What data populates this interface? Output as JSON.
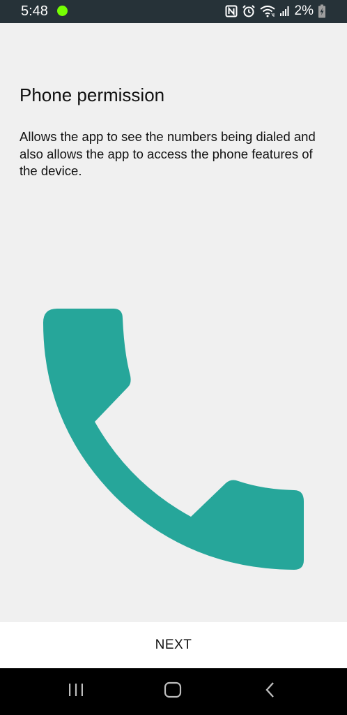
{
  "status_bar": {
    "time": "5:48",
    "battery_text": "2%",
    "background_color": "#263238",
    "dot_color": "#76ff03",
    "icons": [
      "nfc-icon",
      "alarm-icon",
      "wifi-icon",
      "signal-icon",
      "battery-charging-icon"
    ]
  },
  "main": {
    "title": "Phone permission",
    "description": "Allows the app to see the numbers being dialed and also allows the app to access the phone features of the device.",
    "illustration_icon": "phone-icon",
    "illustration_color": "#26a69a"
  },
  "footer": {
    "next_label": "NEXT"
  },
  "nav_bar": {
    "icons": [
      "recent-apps-icon",
      "home-icon",
      "back-icon"
    ]
  }
}
